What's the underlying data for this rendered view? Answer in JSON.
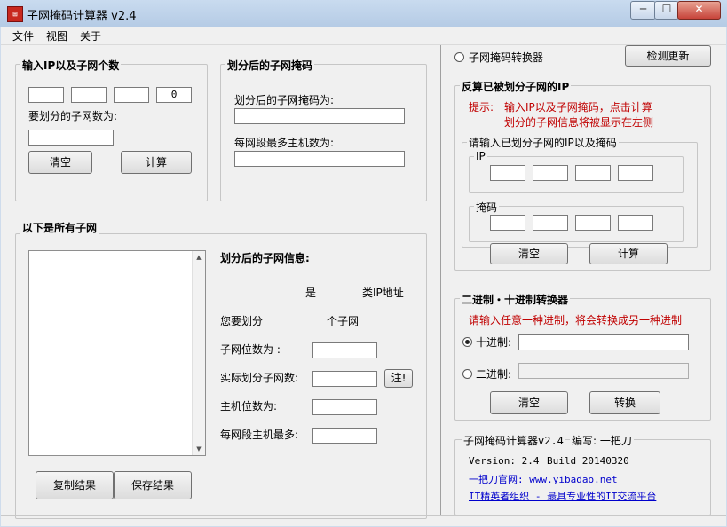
{
  "window": {
    "title": "子网掩码计算器 v2.4",
    "minimize": "─",
    "maximize": "☐",
    "close": "✕"
  },
  "menu": [
    "文件",
    "视图",
    "关于"
  ],
  "input_group": {
    "title": "输入IP以及子网个数",
    "ip_octets": [
      "",
      "",
      "",
      "0"
    ],
    "subnet_count_label": "要划分的子网数为:",
    "subnet_count_value": "",
    "clear_label": "清空",
    "calc_label": "计算"
  },
  "mask_group": {
    "title": "划分后的子网掩码",
    "mask_label": "划分后的子网掩码为:",
    "mask_value": "",
    "hosts_label": "每网段最多主机数为:",
    "hosts_value": ""
  },
  "subnets_group": {
    "title": "以下是所有子网",
    "info_title": "划分后的子网信息:",
    "is_label": "是",
    "class_label": "类IP地址",
    "you_split_label": "您要划分",
    "subnets_suffix": "个子网",
    "subnet_bits_label": "子网位数为 :",
    "actual_subnets_label": "实际划分子网数:",
    "host_bits_label": "主机位数为:",
    "max_hosts_label": "每网段主机最多:",
    "note_label": "注!",
    "copy_label": "复制结果",
    "save_label": "保存结果"
  },
  "right_panel": {
    "converter_radio_label": "子网掩码转换器",
    "check_update_label": "检测更新",
    "reverse_title": "反算已被划分子网的IP",
    "hint_prefix": "提示:",
    "hint_line1": "输入IP以及子网掩码，点击计算",
    "hint_line2": "划分的子网信息将被显示在左侧",
    "input_box_title": "请输入已划分子网的IP以及掩码",
    "ip_title": "IP",
    "mask_title": "掩码",
    "clear_label": "清空",
    "calc_label": "计算"
  },
  "base_converter": {
    "title": "二进制・十进制转换器",
    "hint": "请输入任意一种进制，将会转换成另一种进制",
    "decimal_label": "十进制:",
    "binary_label": "二进制:",
    "clear_label": "清空",
    "convert_label": "转换"
  },
  "about": {
    "title": "子网掩码计算器v2.4",
    "author": "编写: 一把刀",
    "version": "Version: 2.4",
    "build": "Build 20140320",
    "site_link": "一把刀官网: www.yibadao.net",
    "org_link": "IT精英者组织 - 最具专业性的IT交流平台"
  }
}
